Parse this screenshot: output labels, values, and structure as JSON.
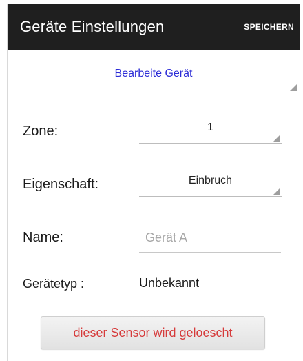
{
  "header": {
    "title": "Geräte Einstellungen",
    "save_label": "SPEICHERN"
  },
  "device_select": {
    "label": "Bearbeite Gerät",
    "color": "#2b2bd6"
  },
  "fields": {
    "zone": {
      "label": "Zone:",
      "value": "1"
    },
    "property": {
      "label": "Eigenschaft:",
      "value": "Einbruch"
    },
    "name": {
      "label": "Name:",
      "value": "",
      "placeholder": "Gerät A"
    },
    "device_type": {
      "label": "Gerätetyp :",
      "value": "Unbekannt"
    }
  },
  "delete_button": {
    "label": "dieser Sensor wird geloescht",
    "color": "#d63b3b"
  },
  "icons": {
    "spinner_indicator": "dropdown-triangle-icon"
  }
}
